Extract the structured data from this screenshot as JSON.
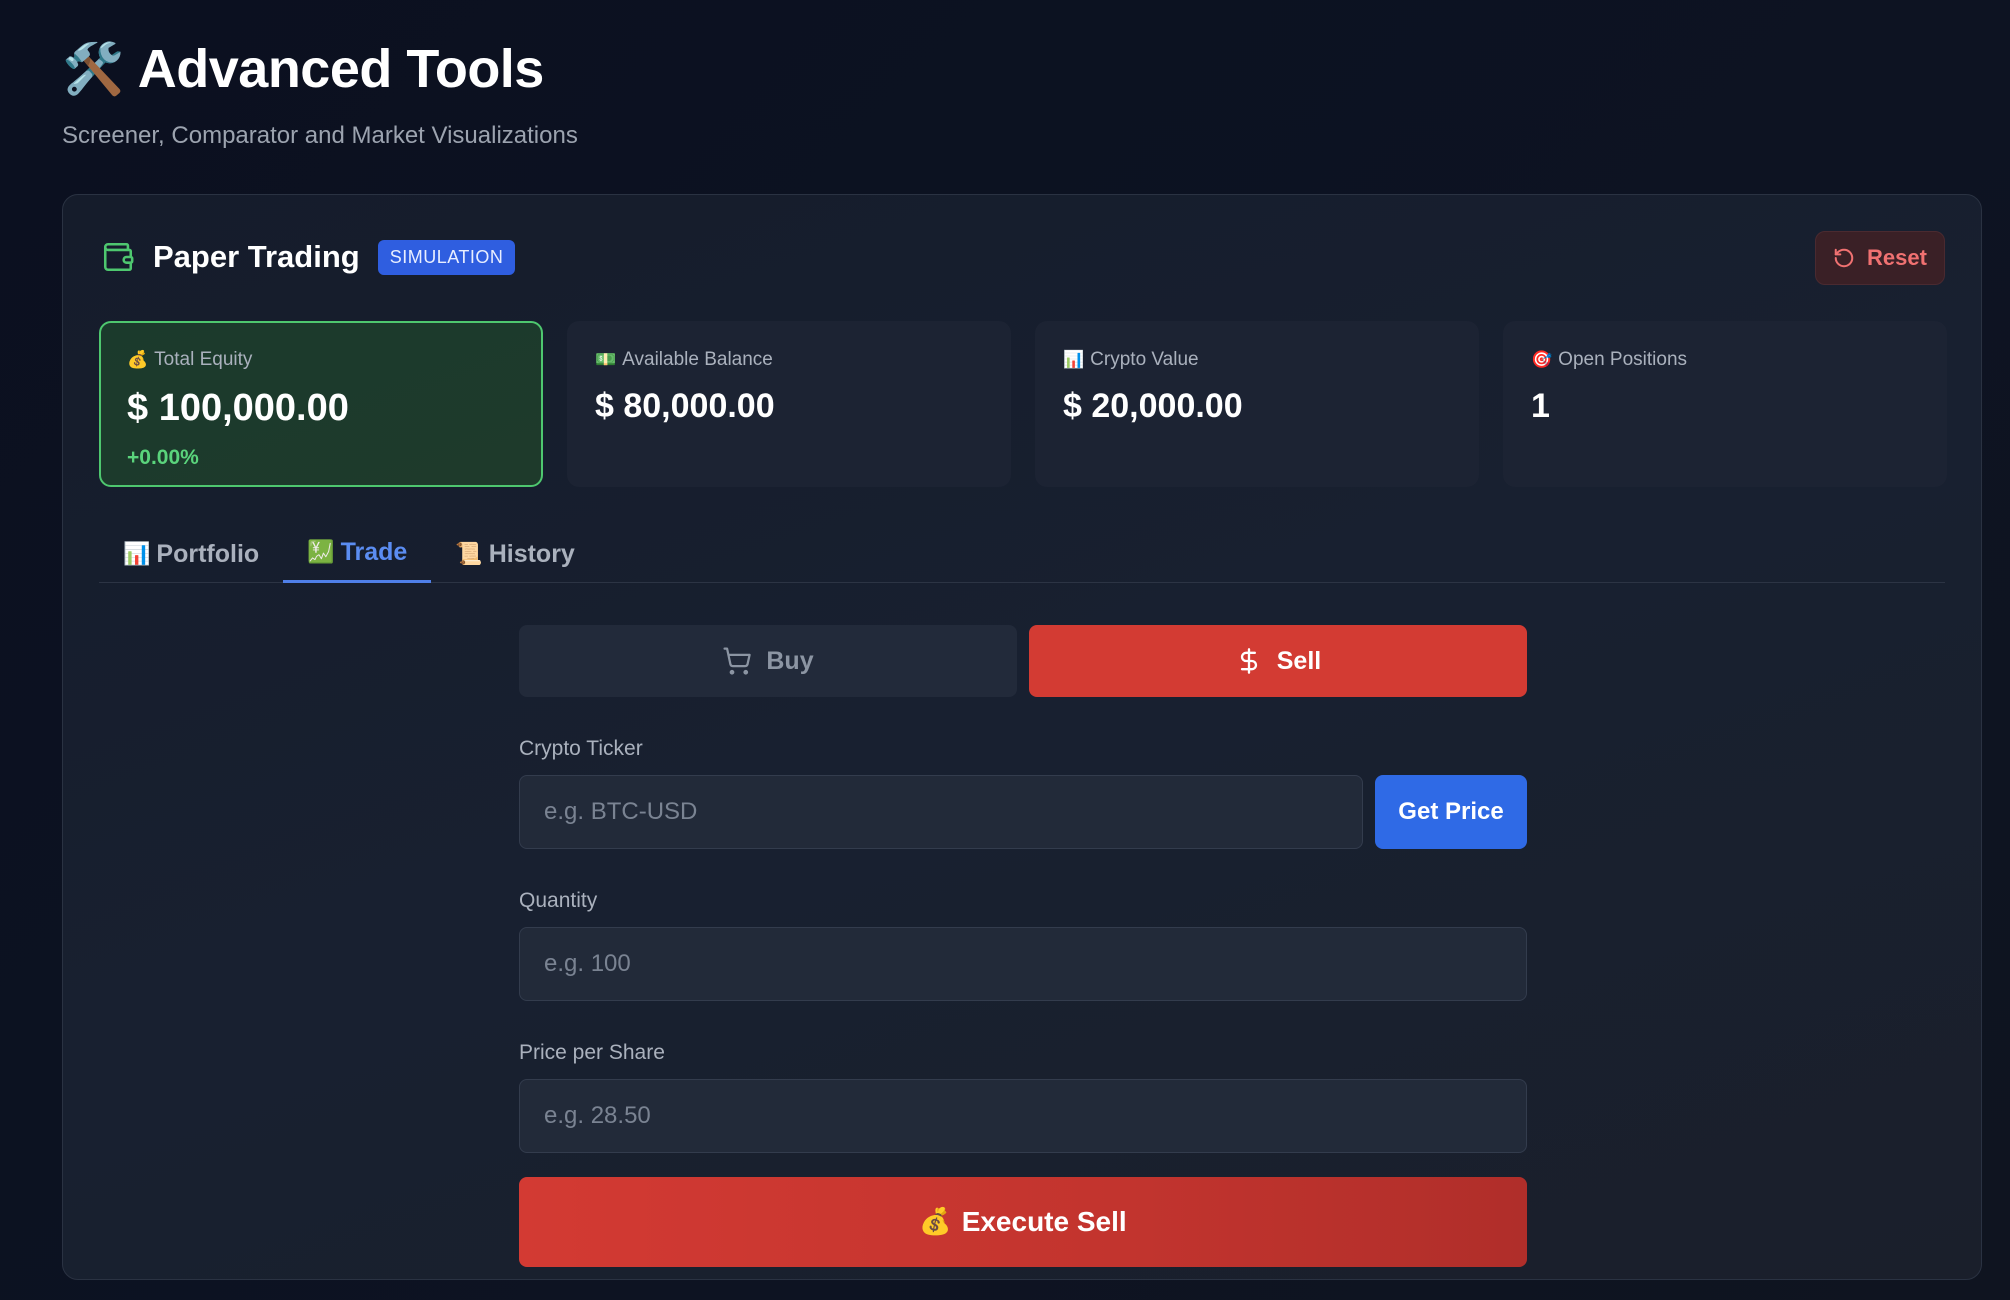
{
  "header": {
    "title_emoji": "🛠️",
    "title": "Advanced Tools",
    "subtitle": "Screener, Comparator and Market Visualizations"
  },
  "panel": {
    "title": "Paper Trading",
    "badge": "SIMULATION",
    "reset_label": "Reset",
    "accent_color": "#4ec76f"
  },
  "stats": [
    {
      "emoji": "💰",
      "label": "Total Equity",
      "value": "$ 100,000.00",
      "change": "+0.00%"
    },
    {
      "emoji": "💵",
      "label": "Available Balance",
      "value": "$ 80,000.00"
    },
    {
      "emoji": "📊",
      "label": "Crypto Value",
      "value": "$ 20,000.00"
    },
    {
      "emoji": "🎯",
      "label": "Open Positions",
      "value": "1"
    }
  ],
  "tabs": [
    {
      "emoji": "📊",
      "label": "Portfolio"
    },
    {
      "emoji": "💹",
      "label": "Trade"
    },
    {
      "emoji": "📜",
      "label": "History"
    }
  ],
  "active_tab": "Trade",
  "form": {
    "buy_label": "Buy",
    "sell_label": "Sell",
    "ticker_label": "Crypto Ticker",
    "ticker_placeholder": "e.g. BTC-USD",
    "get_price_label": "Get Price",
    "quantity_label": "Quantity",
    "quantity_placeholder": "e.g. 100",
    "price_label": "Price per Share",
    "price_placeholder": "e.g. 28.50",
    "execute_emoji": "💰",
    "execute_label": "Execute Sell"
  }
}
